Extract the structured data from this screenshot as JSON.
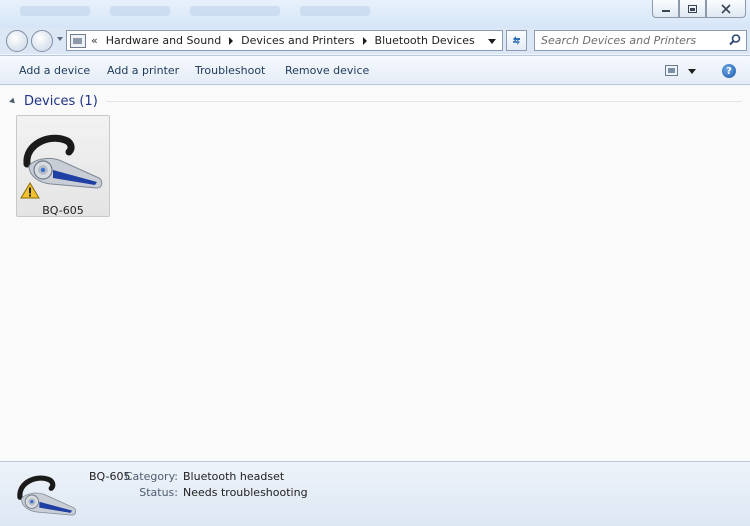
{
  "address": {
    "overflow": "«",
    "crumbs": [
      "Hardware and Sound",
      "Devices and Printers",
      "Bluetooth Devices"
    ]
  },
  "search": {
    "placeholder": "Search Devices and Printers"
  },
  "commands": {
    "add_device": "Add a device",
    "add_printer": "Add a printer",
    "troubleshoot": "Troubleshoot",
    "remove_device": "Remove device",
    "help": "?"
  },
  "group": {
    "title": "Devices (1)"
  },
  "device": {
    "name": "BQ-605",
    "icon": "bluetooth-headset-icon",
    "overlay_icon": "warning-icon"
  },
  "details": {
    "name": "BQ-605",
    "category_label": "Category:",
    "category_value": "Bluetooth headset",
    "status_label": "Status:",
    "status_value": "Needs troubleshooting"
  },
  "colors": {
    "accent": "#1e3287",
    "command_text": "#1e3a5a",
    "warning": "#f2c12e"
  }
}
